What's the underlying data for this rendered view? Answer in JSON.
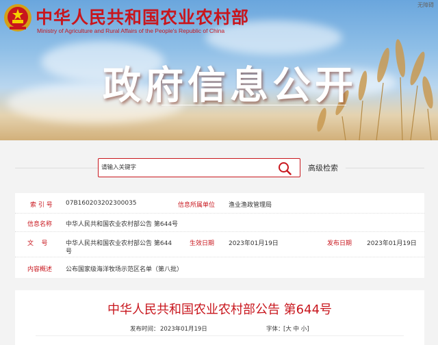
{
  "header": {
    "site_title": "中华人民共和国农业农村部",
    "site_title_en": "Ministry of Agriculture and Rural Affairs of the People's Republic of China",
    "top_link": "无障碍",
    "banner_title": "政府信息公开"
  },
  "search": {
    "placeholder": "请输入关键字",
    "advanced_label": "高级检索"
  },
  "info": {
    "index_label": "索 引 号",
    "index_value": "07B160203202300035",
    "org_label": "信息所属单位",
    "org_value": "渔业渔政管理局",
    "name_label": "信息名称",
    "name_value": "中华人民共和国农业农村部公告 第644号",
    "docno_label": "文    号",
    "docno_value_l1": "中华人民共和国农业农村部公告 第644",
    "docno_value_l2": "号",
    "effective_label": "生效日期",
    "effective_value": "2023年01月19日",
    "publish_label": "发布日期",
    "publish_value": "2023年01月19日",
    "summary_label": "内容概述",
    "summary_value": "公布国家级海洋牧场示范区名单（第八批）"
  },
  "document": {
    "title": "中华人民共和国农业农村部公告 第644号",
    "publish_time_label": "发布时间：",
    "publish_time_value": "2023年01月19日",
    "font_size_label": "字体：",
    "font_size_options": "[大 中 小]"
  },
  "colors": {
    "brand_red": "#c8161d",
    "background": "#f3f3f3"
  }
}
